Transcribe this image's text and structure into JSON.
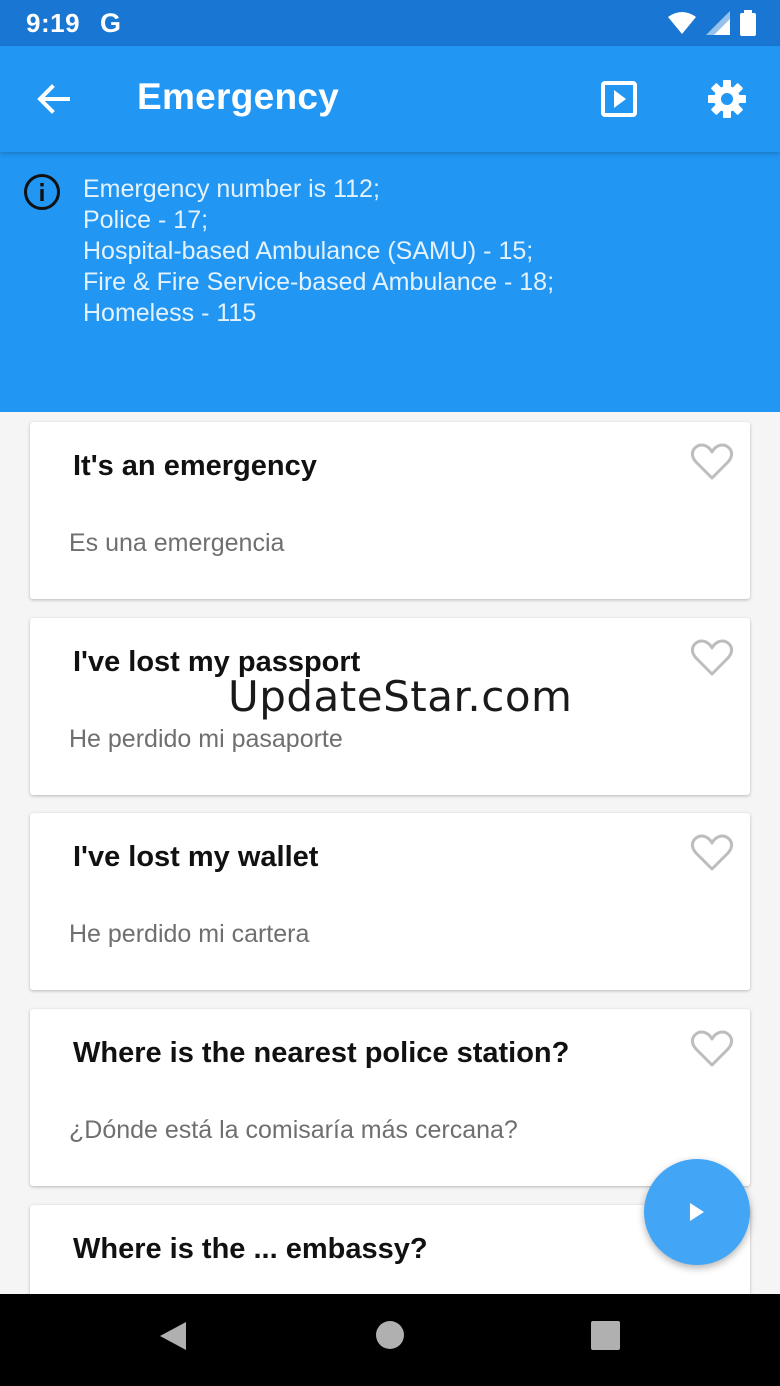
{
  "status": {
    "time": "9:19",
    "app_indicator": "G",
    "icons": [
      "wifi-icon",
      "signal-icon",
      "battery-icon"
    ]
  },
  "header": {
    "title": "Emergency",
    "back_icon": "arrow-left-icon",
    "play_icon": "play-box-icon",
    "settings_icon": "gear-icon"
  },
  "info": {
    "icon": "info-circle-icon",
    "lines": [
      "Emergency number is 112;",
      "Police - 17;",
      "Hospital-based Ambulance (SAMU) - 15;",
      "Fire & Fire Service-based Ambulance - 18;",
      "Homeless - 115"
    ]
  },
  "phrases": [
    {
      "english": "It's an emergency",
      "spanish": "Es una emergencia"
    },
    {
      "english": "I've lost my passport",
      "spanish": "He perdido mi pasaporte"
    },
    {
      "english": "I've lost my wallet",
      "spanish": "He perdido mi cartera"
    },
    {
      "english": "Where is the nearest police station?",
      "spanish": "¿Dónde está la comisaría  más cercana?"
    },
    {
      "english": "Where is the ... embassy?",
      "spanish": ""
    }
  ],
  "watermark": "UpdateStar.com",
  "fab": {
    "icon": "play-icon"
  },
  "colors": {
    "primary": "#2196f3",
    "status_bar": "#1976d2",
    "fab": "#42a5f5",
    "info_text": "#e3f2fd"
  }
}
